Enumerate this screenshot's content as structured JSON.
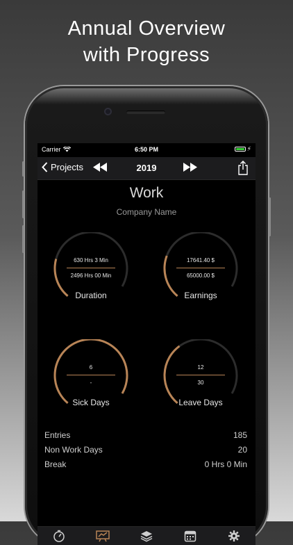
{
  "headline": {
    "line1": "Annual Overview",
    "line2": "with Progress"
  },
  "status_bar": {
    "carrier": "Carrier",
    "time": "6:50 PM"
  },
  "nav": {
    "back_label": "Projects",
    "year": "2019"
  },
  "project": {
    "title": "Work",
    "company": "Company Name"
  },
  "gauges": [
    {
      "label": "Duration",
      "value": "630 Hrs 3 Min",
      "target": "2496 Hrs 00 Min",
      "progress": 0.25
    },
    {
      "label": "Earnings",
      "value": "17641.40 $",
      "target": "65000.00 $",
      "progress": 0.27
    },
    {
      "label": "Sick Days",
      "value": "6",
      "target": "-",
      "progress": 1.0
    },
    {
      "label": "Leave Days",
      "value": "12",
      "target": "30",
      "progress": 0.4
    }
  ],
  "stats": [
    {
      "label": "Entries",
      "value": "185"
    },
    {
      "label": "Non Work Days",
      "value": "20"
    },
    {
      "label": "Break",
      "value": "0 Hrs 0 Min"
    }
  ],
  "tabs": [
    {
      "icon": "timer-icon",
      "active": false
    },
    {
      "icon": "chart-icon",
      "active": true
    },
    {
      "icon": "layers-icon",
      "active": false
    },
    {
      "icon": "calendar-icon",
      "active": false
    },
    {
      "icon": "gear-icon",
      "active": false
    }
  ],
  "colors": {
    "accent": "#b88456",
    "track": "#2c2c2c",
    "navbar": "#1c1c1e"
  }
}
